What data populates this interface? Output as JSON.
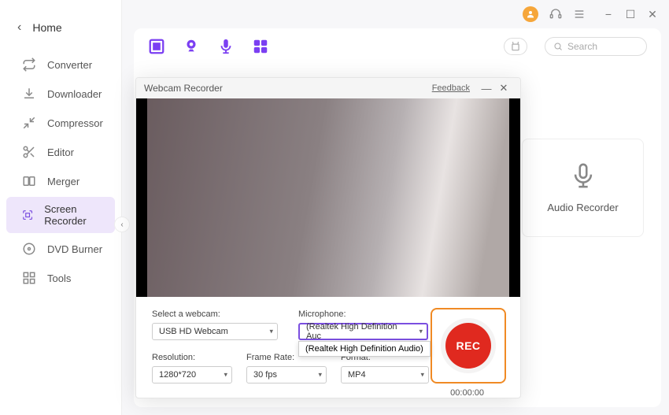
{
  "titlebar": {},
  "sidebar": {
    "home_label": "Home",
    "items": [
      {
        "label": "Converter"
      },
      {
        "label": "Downloader"
      },
      {
        "label": "Compressor"
      },
      {
        "label": "Editor"
      },
      {
        "label": "Merger"
      },
      {
        "label": "Screen Recorder"
      },
      {
        "label": "DVD Burner"
      },
      {
        "label": "Tools"
      }
    ],
    "selected_index": 5
  },
  "search": {
    "placeholder": "Search"
  },
  "card_audio": {
    "label": "Audio Recorder"
  },
  "modal": {
    "title": "Webcam Recorder",
    "feedback_label": "Feedback",
    "fields": {
      "webcam_label": "Select a webcam:",
      "webcam_value": "USB HD Webcam",
      "mic_label": "Microphone:",
      "mic_value": "(Realtek High Definition Auc",
      "mic_option": "(Realtek High Definition Audio)",
      "resolution_label": "Resolution:",
      "resolution_value": "1280*720",
      "framerate_label": "Frame Rate:",
      "framerate_value": "30 fps",
      "format_label": "Format:",
      "format_value": "MP4"
    },
    "rec_label": "REC",
    "timer": "00:00:00"
  }
}
